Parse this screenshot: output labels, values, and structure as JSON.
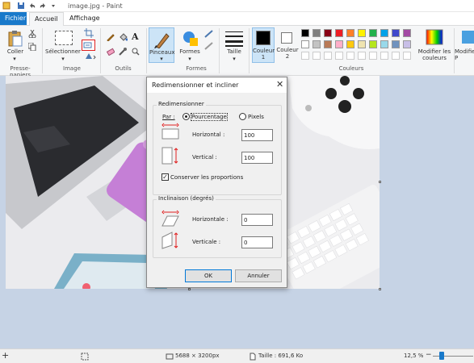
{
  "window": {
    "title": "image.jpg - Paint"
  },
  "tabs": {
    "file": "Fichier",
    "home": "Accueil",
    "view": "Affichage"
  },
  "ribbon": {
    "paste": "Coller",
    "select": "Sélectionner",
    "brushes": "Pinceaux",
    "shapes": "Formes",
    "size": "Taille",
    "color1": "Couleur 1",
    "color2": "Couleur 2",
    "edit_colors": "Modifier les couleurs",
    "edit_paint3d": "Modifier P",
    "groups": {
      "clipboard": "Presse-papiers",
      "image": "Image",
      "tools": "Outils",
      "shapes": "Formes",
      "colors": "Couleurs"
    },
    "palette_row1": [
      "#000000",
      "#7f7f7f",
      "#880015",
      "#ed1c24",
      "#ff7f27",
      "#fff200",
      "#22b14c",
      "#00a2e8",
      "#3f48cc",
      "#a349a4"
    ],
    "palette_row2": [
      "#ffffff",
      "#c3c3c3",
      "#b97a57",
      "#ffaec9",
      "#ffc90e",
      "#efe4b0",
      "#b5e61d",
      "#99d9ea",
      "#7092be",
      "#c8bfe7"
    ]
  },
  "dialog": {
    "title": "Redimensionner et incliner",
    "resize_group": "Redimensionner",
    "by_label": "Par :",
    "percent": "Pourcentage",
    "pixels": "Pixels",
    "horizontal_label": "Horizontal :",
    "horizontal_value": "100",
    "vertical_label": "Vertical :",
    "vertical_value": "100",
    "keep_ratio": "Conserver les proportions",
    "skew_group": "Inclinaison (degrés)",
    "skew_h_label": "Horizontale :",
    "skew_h_value": "0",
    "skew_v_label": "Verticale :",
    "skew_v_value": "0",
    "ok": "OK",
    "cancel": "Annuler"
  },
  "status": {
    "dimensions": "5688 × 3200px",
    "size": "Taille : 691,6 Ko",
    "zoom": "12,5 %"
  }
}
